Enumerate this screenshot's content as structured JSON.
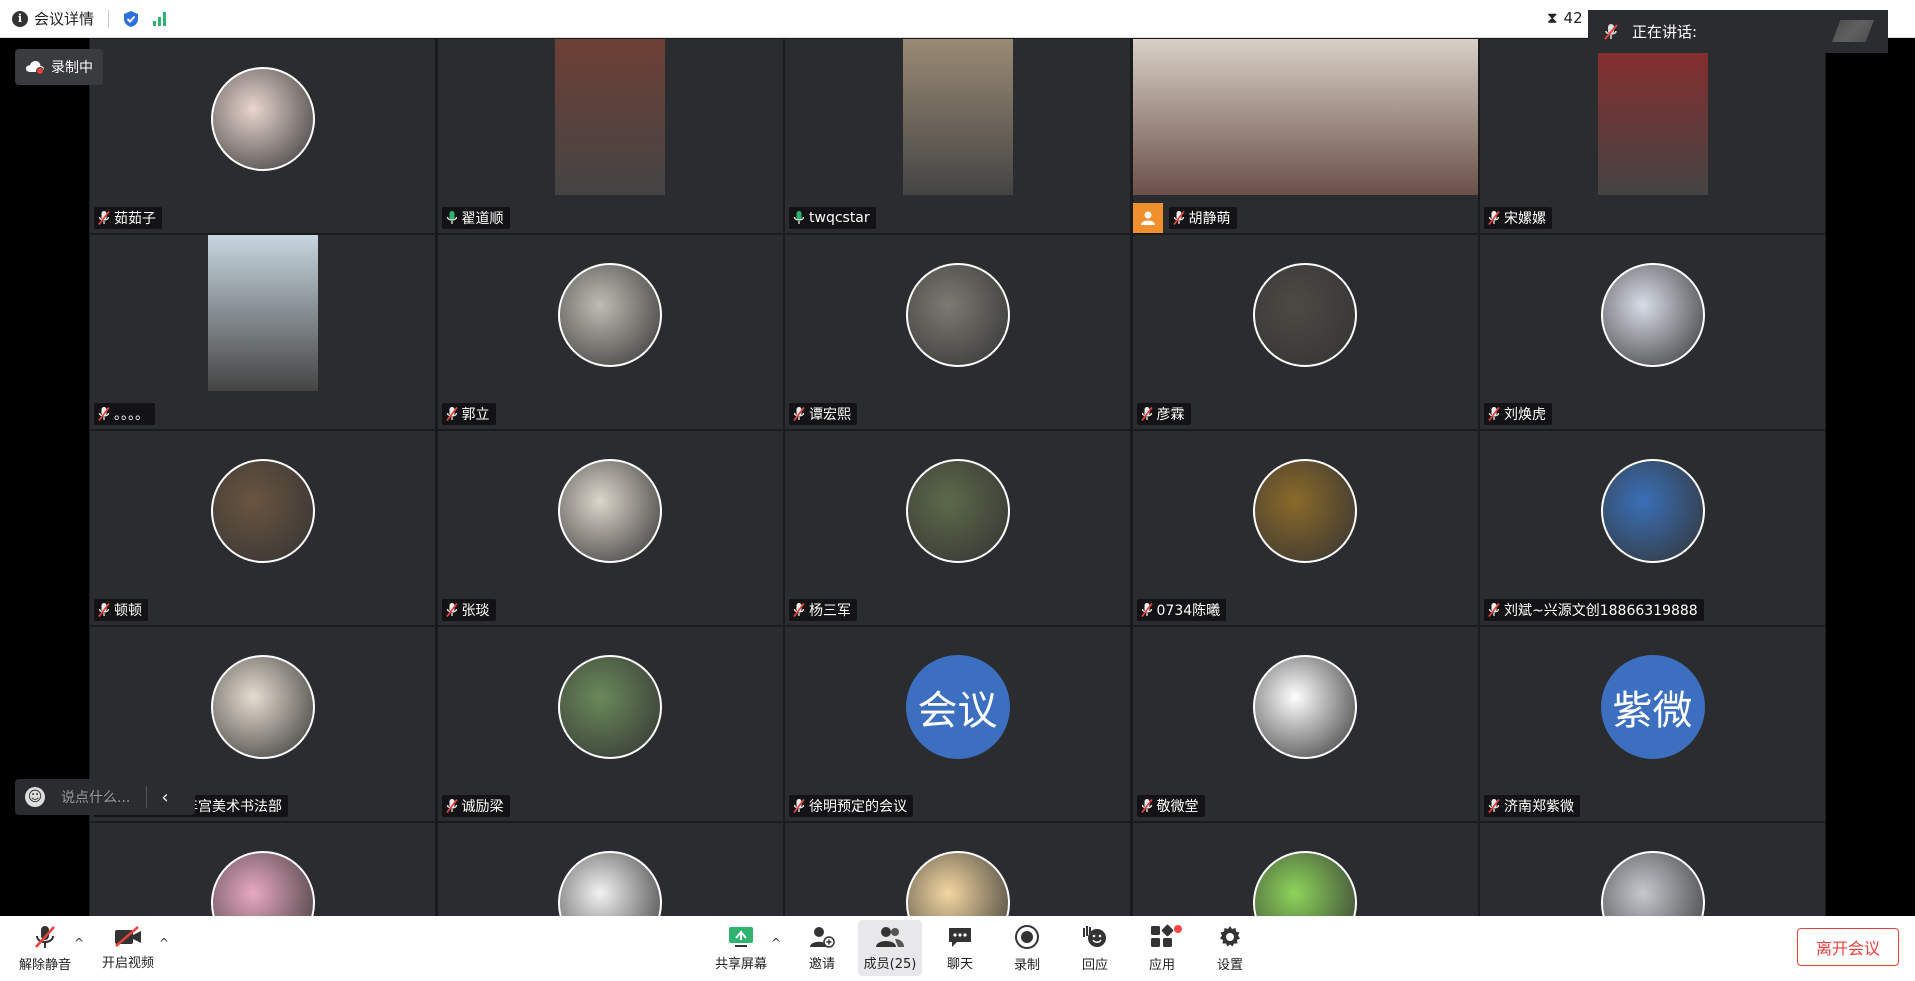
{
  "topbar": {
    "meeting_details": "会议详情",
    "timer": "42"
  },
  "speaking": {
    "label": "正在讲话:"
  },
  "recording": {
    "label": "录制中"
  },
  "chat": {
    "placeholder": "说点什么..."
  },
  "participants": [
    {
      "name": "茹茹子",
      "kind": "avatar",
      "bg": "#e9d6cf",
      "mic": "off"
    },
    {
      "name": "翟道顺",
      "kind": "video",
      "bg": "#6e4036",
      "mic": "on"
    },
    {
      "name": "twqcstar",
      "kind": "video",
      "bg": "#9a8a74",
      "mic": "on"
    },
    {
      "name": "胡静萌",
      "kind": "video-wide",
      "bg": "#d8cfc6",
      "mic": "off",
      "badge": true
    },
    {
      "name": "宋嫘嫘",
      "kind": "video",
      "bg": "#8b2c2c",
      "mic": "off"
    },
    {
      "name": "。。。。",
      "kind": "video",
      "bg": "#c7d6e0",
      "mic": "off"
    },
    {
      "name": "郭立",
      "kind": "avatar",
      "bg": "#bfbcb2",
      "mic": "off"
    },
    {
      "name": "谭宏熙",
      "kind": "avatar",
      "bg": "#7c7a72",
      "mic": "off"
    },
    {
      "name": "彦霖",
      "kind": "avatar",
      "bg": "#4d4a44",
      "mic": "off"
    },
    {
      "name": "刘焕虎",
      "kind": "avatar",
      "bg": "#d9dde8",
      "mic": "off"
    },
    {
      "name": "顿顿",
      "kind": "avatar",
      "bg": "#6a5540",
      "mic": "off"
    },
    {
      "name": "张琰",
      "kind": "avatar",
      "bg": "#dcd6cb",
      "mic": "off"
    },
    {
      "name": "杨三军",
      "kind": "avatar",
      "bg": "#5d6a4a",
      "mic": "off"
    },
    {
      "name": "0734陈曦",
      "kind": "avatar",
      "bg": "#8a6a2a",
      "mic": "off"
    },
    {
      "name": "刘斌~兴源文创18866319888",
      "kind": "avatar",
      "bg": "#3a70b8",
      "mic": "off"
    },
    {
      "name": "济南市青少年宫美术书法部",
      "kind": "avatar",
      "bg": "#e6ddd0",
      "mic": "off"
    },
    {
      "name": "诚励梁",
      "kind": "avatar",
      "bg": "#6a8a5a",
      "mic": "off"
    },
    {
      "name": "徐明预定的会议",
      "kind": "text",
      "bg": "#3c6fbf",
      "text": "会议",
      "mic": "off"
    },
    {
      "name": "敬微堂",
      "kind": "avatar",
      "bg": "#ffffff",
      "mic": "off"
    },
    {
      "name": "济南郑紫微",
      "kind": "text",
      "bg": "#3c6fbf",
      "text": "紫微",
      "mic": "off"
    },
    {
      "name": "",
      "kind": "avatar",
      "bg": "#e8a8c0",
      "mic": "off"
    },
    {
      "name": "",
      "kind": "avatar",
      "bg": "#f2f2f2",
      "mic": "off"
    },
    {
      "name": "",
      "kind": "avatar",
      "bg": "#f3d7a0",
      "mic": "off"
    },
    {
      "name": "",
      "kind": "avatar",
      "bg": "#8cd45a",
      "mic": "off"
    },
    {
      "name": "",
      "kind": "avatar",
      "bg": "#c5c8ce",
      "mic": "off"
    }
  ],
  "toolbar": {
    "unmute": "解除静音",
    "start_video": "开启视频",
    "share_screen": "共享屏幕",
    "invite": "邀请",
    "members": "成员(25)",
    "chat": "聊天",
    "record": "录制",
    "react": "回应",
    "apps": "应用",
    "settings": "设置",
    "leave": "离开会议"
  },
  "colors": {
    "tile_bg": "#2b2c2f",
    "accent_green": "#2fb36f",
    "leave_red": "#e8413c",
    "badge_orange": "#f0902c"
  }
}
